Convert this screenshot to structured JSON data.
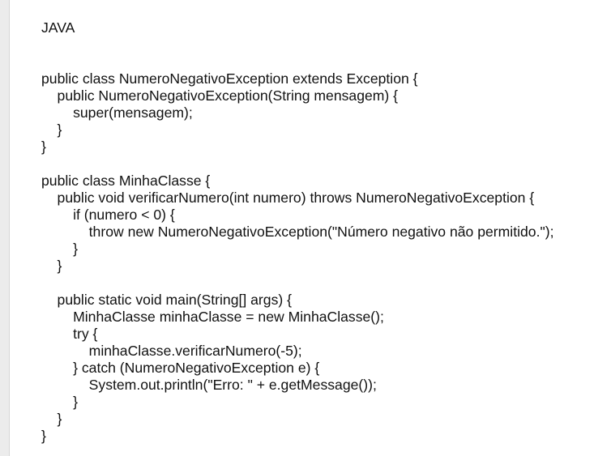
{
  "document": {
    "heading": "JAVA",
    "code_lines": [
      "public class NumeroNegativoException extends Exception {",
      "    public NumeroNegativoException(String mensagem) {",
      "        super(mensagem);",
      "    }",
      "}",
      "",
      "public class MinhaClasse {",
      "    public void verificarNumero(int numero) throws NumeroNegativoException {",
      "        if (numero < 0) {",
      "            throw new NumeroNegativoException(\"Número negativo não permitido.\");",
      "        }",
      "    }",
      "",
      "    public static void main(String[] args) {",
      "        MinhaClasse minhaClasse = new MinhaClasse();",
      "        try {",
      "            minhaClasse.verificarNumero(-5);",
      "        } catch (NumeroNegativoException e) {",
      "            System.out.println(\"Erro: \" + e.getMessage());",
      "        }",
      "    }",
      "}"
    ]
  }
}
